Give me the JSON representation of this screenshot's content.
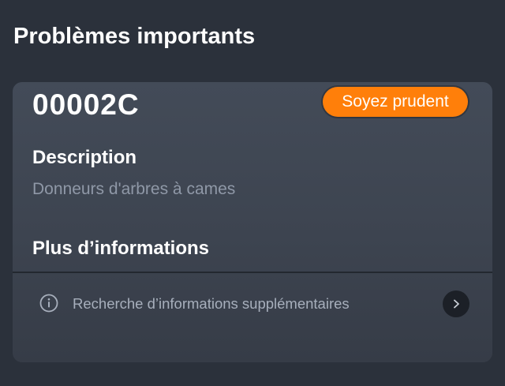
{
  "section": {
    "title": "Problèmes importants"
  },
  "issue": {
    "code": "00002C",
    "badge": {
      "label": "Soyez prudent",
      "color": "#ff7f0a"
    },
    "description_label": "Description",
    "description_value": "Donneurs d'arbres à cames",
    "more_info_label": "Plus d’informations",
    "info_link": {
      "icon": "info-icon",
      "label": "Recherche d’informations supplémentaires",
      "action_icon": "chevron-right-icon"
    }
  }
}
